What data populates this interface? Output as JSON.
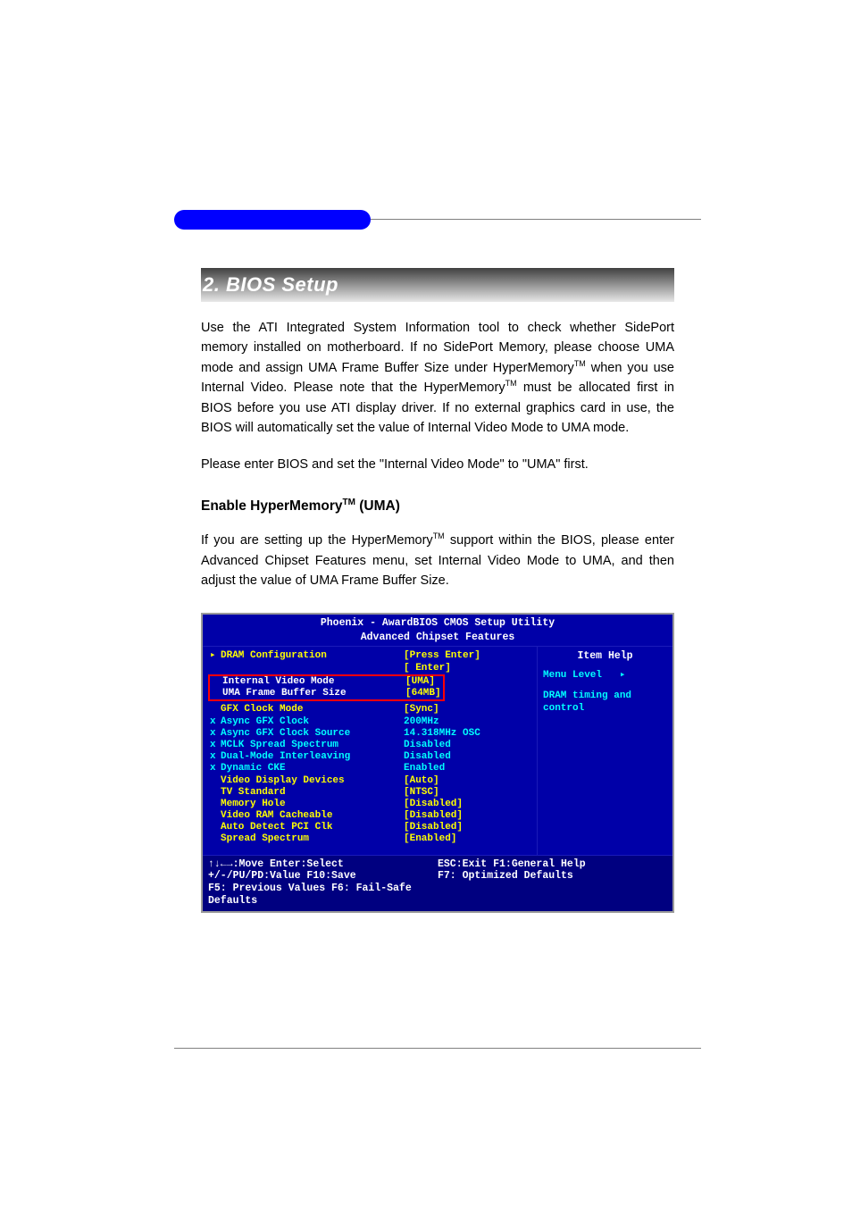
{
  "section_title": "2. BIOS Setup",
  "para1_a": "Use the ATI Integrated System Information tool to check whether SidePort memory installed on motherboard. If no SidePort Memory, please choose UMA mode and assign UMA Frame Buffer Size under HyperMemory",
  "para1_b": " when you use Internal Video. Please note that the HyperMemory",
  "para1_c": " must be allocated first in BIOS before you use ATI display driver. If no external graphics card in use, the BIOS will automatically set the value of Internal Video Mode to UMA mode.",
  "para2": "Please enter BIOS and set the \"Internal Video Mode\" to \"UMA\" first.",
  "subhead_a": "Enable HyperMemory",
  "subhead_b": " (UMA)",
  "para3_a": "If you are setting up the HyperMemory",
  "para3_b": " support within the BIOS, please enter Advanced Chipset Features menu, set Internal Video Mode to UMA, and then adjust the value of UMA Frame Buffer Size.",
  "bios": {
    "title1": "Phoenix - AwardBIOS CMOS Setup Utility",
    "title2": "Advanced Chipset Features",
    "rows": [
      {
        "marker": "▸",
        "label": "DRAM Configuration",
        "value": "[Press Enter]",
        "lcls": "yellow",
        "vcls": "yellow"
      },
      {
        "marker": "",
        "label": "",
        "value": "[     Enter]",
        "lcls": "yellow",
        "vcls": "yellow"
      },
      {
        "marker": "",
        "label": "Internal Video Mode",
        "value": "[UMA]",
        "lcls": "white",
        "vcls": "yellow",
        "boxed": true
      },
      {
        "marker": "",
        "label": "UMA Frame Buffer Size",
        "value": "[64MB]",
        "lcls": "white",
        "vcls": "yellow",
        "boxed": true
      },
      {
        "marker": "",
        "label": "GFX Clock Mode",
        "value": "[Sync]",
        "lcls": "yellow",
        "vcls": "yellow"
      },
      {
        "marker": "x",
        "label": "Async GFX Clock",
        "value": "200MHz",
        "lcls": "cyan",
        "vcls": "cyan"
      },
      {
        "marker": "x",
        "label": "Async GFX Clock Source",
        "value": "14.318MHz OSC",
        "lcls": "cyan",
        "vcls": "cyan"
      },
      {
        "marker": "x",
        "label": "MCLK Spread Spectrum",
        "value": "Disabled",
        "lcls": "cyan",
        "vcls": "cyan"
      },
      {
        "marker": "x",
        "label": "Dual-Mode Interleaving",
        "value": "Disabled",
        "lcls": "cyan",
        "vcls": "cyan"
      },
      {
        "marker": "x",
        "label": "Dynamic CKE",
        "value": "Enabled",
        "lcls": "cyan",
        "vcls": "cyan"
      },
      {
        "marker": "",
        "label": "Video Display Devices",
        "value": "[Auto]",
        "lcls": "yellow",
        "vcls": "yellow"
      },
      {
        "marker": "",
        "label": "TV Standard",
        "value": "[NTSC]",
        "lcls": "yellow",
        "vcls": "yellow"
      },
      {
        "marker": "",
        "label": "Memory Hole",
        "value": "[Disabled]",
        "lcls": "yellow",
        "vcls": "yellow"
      },
      {
        "marker": "",
        "label": "Video RAM Cacheable",
        "value": "[Disabled]",
        "lcls": "yellow",
        "vcls": "yellow"
      },
      {
        "marker": "",
        "label": "Auto Detect PCI Clk",
        "value": "[Disabled]",
        "lcls": "yellow",
        "vcls": "yellow"
      },
      {
        "marker": "",
        "label": "Spread Spectrum",
        "value": "[Enabled]",
        "lcls": "yellow",
        "vcls": "yellow"
      }
    ],
    "help_title": "Item Help",
    "help_menu": "Menu Level",
    "help_arrow": "▸",
    "help_text": "DRAM timing and control",
    "footer_l1": "↑↓←→:Move  Enter:Select  +/-/PU/PD:Value  F10:Save",
    "footer_r1": "ESC:Exit  F1:General Help",
    "footer_l2": "F5: Previous Values    F6: Fail-Safe Defaults",
    "footer_r2": "F7: Optimized Defaults"
  }
}
